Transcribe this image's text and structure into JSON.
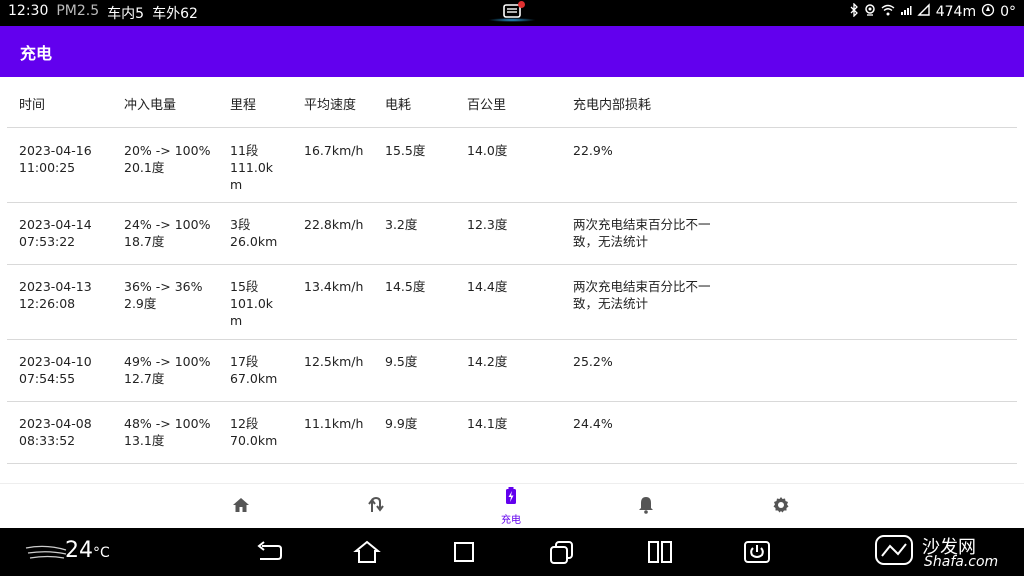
{
  "status_bar": {
    "time": "12:30",
    "pm_label": "PM2.5",
    "inside_label": "车内",
    "inside_value": "5",
    "outside_label": "车外",
    "outside_value": "62",
    "distance": "474m",
    "temp_right": "0°"
  },
  "app_bar": {
    "title": "充电"
  },
  "table": {
    "headers": [
      "时间",
      "冲入电量",
      "里程",
      "平均速度",
      "电耗",
      "百公里",
      "充电内部损耗"
    ],
    "rows": [
      {
        "time": "2023-04-16\n11:00:25",
        "charge": "20% -> 100%\n20.1度",
        "mileage": "11段\n111.0km",
        "speed": "16.7km/h",
        "consumption": "15.5度",
        "per100": "14.0度",
        "loss": "22.9%"
      },
      {
        "time": "2023-04-14\n07:53:22",
        "charge": "24% -> 100%\n18.7度",
        "mileage": "3段\n26.0km",
        "speed": "22.8km/h",
        "consumption": "3.2度",
        "per100": "12.3度",
        "loss": "两次充电结束百分比不一致，无法统计"
      },
      {
        "time": "2023-04-13\n12:26:08",
        "charge": "36% -> 36%\n2.9度",
        "mileage": "15段\n101.0km",
        "speed": "13.4km/h",
        "consumption": "14.5度",
        "per100": "14.4度",
        "loss": "两次充电结束百分比不一致，无法统计"
      },
      {
        "time": "2023-04-10\n07:54:55",
        "charge": "49% -> 100%\n12.7度",
        "mileage": "17段\n67.0km",
        "speed": "12.5km/h",
        "consumption": "9.5度",
        "per100": "14.2度",
        "loss": "25.2%"
      },
      {
        "time": "2023-04-08\n08:33:52",
        "charge": "48% -> 100%\n13.1度",
        "mileage": "12段\n70.0km",
        "speed": "11.1km/h",
        "consumption": "9.9度",
        "per100": "14.1度",
        "loss": "24.4%"
      }
    ]
  },
  "bottom_nav": {
    "items": [
      {
        "icon": "home-icon"
      },
      {
        "icon": "route-icon"
      },
      {
        "icon": "charging-icon",
        "label": "充电",
        "active": true
      },
      {
        "icon": "bell-icon"
      },
      {
        "icon": "gear-icon"
      }
    ],
    "accent": "#6200ee"
  },
  "system_nav": {
    "temperature": "24",
    "temp_unit": "°C",
    "watermark_cn": "沙发网",
    "watermark_en": "Shafa.com"
  }
}
